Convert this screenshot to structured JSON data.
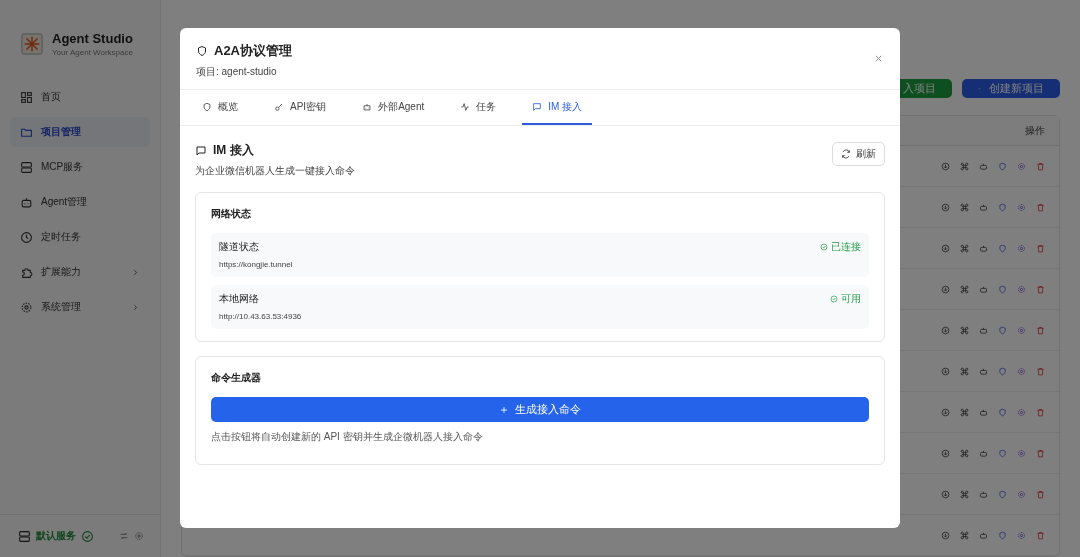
{
  "sidebar": {
    "app_name": "Agent Studio",
    "app_subtitle": "Your Agent Workspace",
    "items": [
      {
        "kind": "grid",
        "label": "首页",
        "selected": false,
        "expandable": false
      },
      {
        "kind": "folder",
        "label": "项目管理",
        "selected": true,
        "expandable": false
      },
      {
        "kind": "server",
        "label": "MCP服务",
        "selected": false,
        "expandable": false
      },
      {
        "kind": "bot",
        "label": "Agent管理",
        "selected": false,
        "expandable": false
      },
      {
        "kind": "clock",
        "label": "定时任务",
        "selected": false,
        "expandable": false
      },
      {
        "kind": "puzzle",
        "label": "扩展能力",
        "selected": false,
        "expandable": true
      },
      {
        "kind": "gear",
        "label": "系统管理",
        "selected": false,
        "expandable": true
      }
    ],
    "footer": {
      "service": "默认服务",
      "ok": true
    }
  },
  "page": {
    "import_button": "入项目",
    "create_button": "创建新项目"
  },
  "table": {
    "actions_header": "操作"
  },
  "modal": {
    "title": "A2A协议管理",
    "subtitle": "项目: agent-studio",
    "tabs": [
      {
        "kind": "shield",
        "label": "概览",
        "selected": false
      },
      {
        "kind": "key",
        "label": "API密钥",
        "selected": false
      },
      {
        "kind": "bot",
        "label": "外部Agent",
        "selected": false
      },
      {
        "kind": "activity",
        "label": "任务",
        "selected": false
      },
      {
        "kind": "chat",
        "label": "IM 接入",
        "selected": true
      }
    ],
    "section_title": "IM 接入",
    "section_desc": "为企业微信机器人生成一键接入命令",
    "refresh_button": "刷新",
    "network": {
      "title": "网络状态",
      "items": [
        {
          "label": "隧道状态",
          "url": "https://kongjie.tunnel",
          "status": "已连接",
          "ok": true
        },
        {
          "label": "本地网络",
          "url": "http://10.43.63.53:4936",
          "status": "可用",
          "ok": true
        }
      ]
    },
    "generator": {
      "title": "命令生成器",
      "button": "生成接入命令",
      "hint": "点击按钮将自动创建新的 API 密钥并生成企微机器人接入命令"
    }
  }
}
